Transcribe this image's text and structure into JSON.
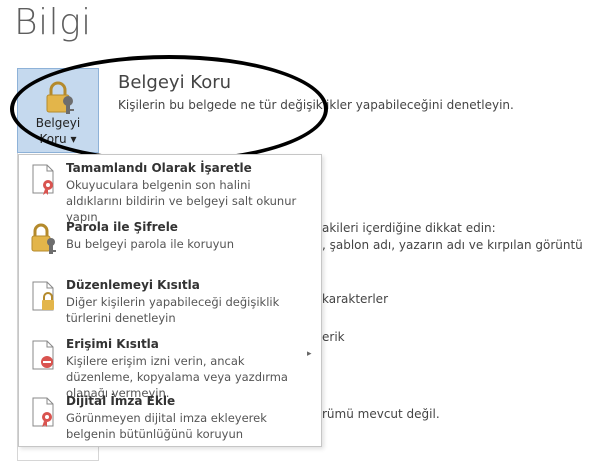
{
  "page": {
    "title": "Bilgi"
  },
  "protect_button": {
    "line1": "Belgeyi",
    "line2": "Koru ▾"
  },
  "section": {
    "heading": "Belgeyi Koru",
    "description": "Kişilerin bu belgede ne tür değişiklikler yapabileceğini denetleyin."
  },
  "background_text": {
    "line1": "akileri içerdiğine dikkat edin:",
    "line2": ", şablon adı, yazarın adı ve kırpılan görüntü",
    "line3": "karakterler",
    "line4": "erik",
    "line5": "rümü mevcut değil."
  },
  "menu": {
    "items": [
      {
        "title": "Tamamlandı Olarak İşaretle",
        "desc": "Okuyuculara belgenin son halini aldıklarını bildirin ve belgeyi salt okunur yapın",
        "icon": "ribbon-document-icon"
      },
      {
        "title": "Parola ile Şifrele",
        "desc": "Bu belgeyi parola ile koruyun",
        "icon": "lock-key-icon"
      },
      {
        "title": "Düzenlemeyi Kısıtla",
        "desc": "Diğer kişilerin yapabileceği değişiklik türlerini denetleyin",
        "icon": "locked-document-icon"
      },
      {
        "title": "Erişimi Kısıtla",
        "desc": "Kişilere erişim izni verin, ancak düzenleme, kopyalama veya yazdırma olanağı vermeyin.",
        "icon": "restricted-document-icon"
      },
      {
        "title": "Dijital İmza Ekle",
        "desc": "Görünmeyen dijital imza ekleyerek belgenin bütünlüğünü koruyun",
        "icon": "signature-document-icon"
      }
    ],
    "submenu_glyph": "▸"
  },
  "colors": {
    "button_bg": "#c5d9ee",
    "lock_gold": "#e3b54a",
    "badge_red": "#d9534f"
  }
}
